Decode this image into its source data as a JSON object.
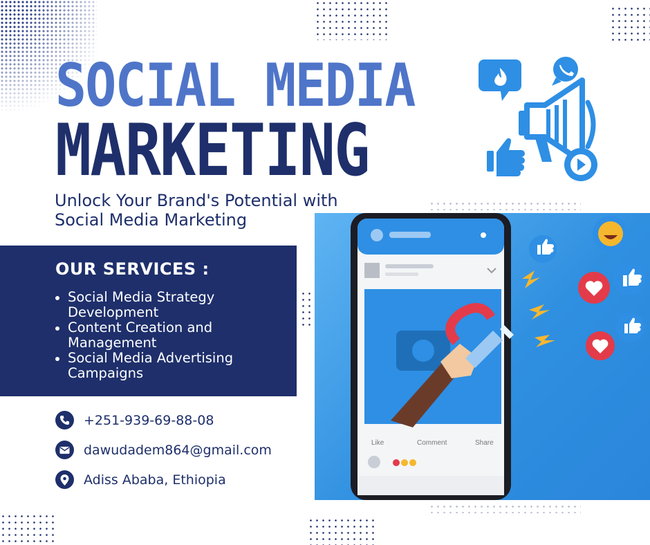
{
  "title": {
    "line1": "SOCIAL MEDIA",
    "line2": "MARKETING"
  },
  "subtitle": "Unlock Your Brand's Potential with Social Media Marketing",
  "services": {
    "heading": "OUR SERVICES :",
    "items": [
      {
        "label": "Social Media Strategy Development"
      },
      {
        "label": "Content Creation and Management"
      },
      {
        "label": "Social Media Advertising Campaigns"
      }
    ]
  },
  "contacts": {
    "phone": "+251-939-69-88-08",
    "email": "dawudadem864@gmail.com",
    "location": "Adiss Ababa, Ethiopia"
  },
  "phone_post": {
    "actions": [
      "Like",
      "Comment",
      "Share"
    ]
  },
  "colors": {
    "navy": "#1e2f6b",
    "accent_blue": "#4f75c9",
    "sky_blue": "#2e8fe4",
    "heart_red": "#e33b4a"
  },
  "icons": [
    "phone-icon",
    "mail-icon",
    "location-icon",
    "megaphone-icon",
    "like-icon",
    "heart-icon",
    "laugh-emoji-icon",
    "magnet-icon",
    "play-icon",
    "fire-icon"
  ]
}
